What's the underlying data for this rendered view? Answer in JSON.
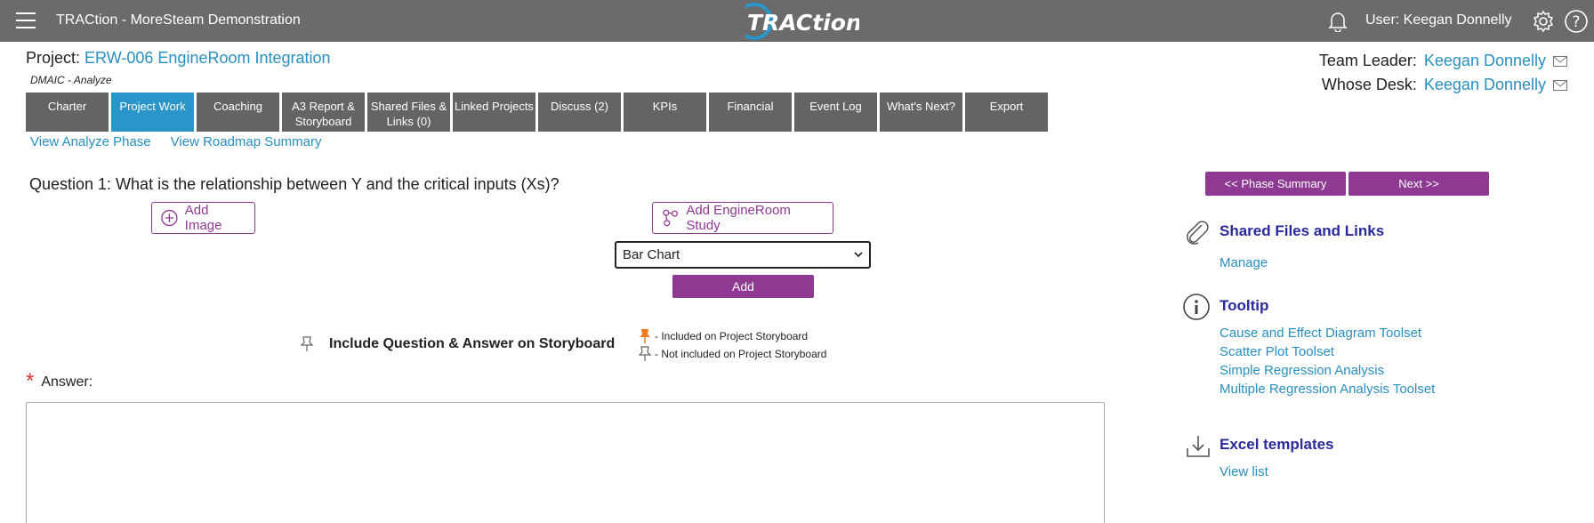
{
  "topbar": {
    "app_title": "TRACtion - MoreSteam Demonstration",
    "logo_text": "TRACtion",
    "user": "User: Keegan Donnelly"
  },
  "project": {
    "label": "Project:",
    "name": "ERW-006 EngineRoom Integration",
    "phase": "DMAIC - Analyze",
    "team_leader_label": "Team Leader:",
    "team_leader": "Keegan Donnelly",
    "whose_desk_label": "Whose Desk:",
    "whose_desk": "Keegan Donnelly"
  },
  "tabs": [
    {
      "label": "Charter",
      "active": false
    },
    {
      "label": "Project Work",
      "active": true
    },
    {
      "label": "Coaching",
      "active": false
    },
    {
      "label": "A3 Report & Storyboard",
      "active": false
    },
    {
      "label": "Shared Files & Links (0)",
      "active": false
    },
    {
      "label": "Linked Projects",
      "active": false
    },
    {
      "label": "Discuss (2)",
      "active": false
    },
    {
      "label": "KPIs",
      "active": false
    },
    {
      "label": "Financial",
      "active": false
    },
    {
      "label": "Event Log",
      "active": false
    },
    {
      "label": "What's Next?",
      "active": false
    },
    {
      "label": "Export",
      "active": false
    }
  ],
  "sublinks": {
    "analyze": "View Analyze Phase",
    "roadmap": "View Roadmap Summary"
  },
  "question": {
    "text": "Question 1: What is the relationship between Y and the critical inputs (Xs)?",
    "add_image": "Add Image",
    "add_engineroom": "Add EngineRoom Study",
    "chart_select": "Bar Chart",
    "add_button": "Add",
    "include_label": "Include Question & Answer on Storyboard",
    "legend_included": "- Included on Project Storyboard",
    "legend_not_included": "- Not included on Project Storyboard",
    "answer_label": "Answer:",
    "required_mark": "*"
  },
  "nav_buttons": {
    "phase_summary": "<< Phase Summary",
    "next": "Next >>"
  },
  "sidebar": {
    "shared_title": "Shared Files and Links",
    "shared_manage": "Manage",
    "tooltip_title": "Tooltip",
    "tooltip_links": [
      "Cause and Effect Diagram Toolset",
      "Scatter Plot Toolset",
      "Simple Regression Analysis",
      "Multiple Regression Analysis Toolset"
    ],
    "excel_title": "Excel templates",
    "excel_link": "View list"
  },
  "colors": {
    "topbar": "#6b6b6b",
    "accent_purple": "#8e3a93",
    "link_blue": "#2a8fc1",
    "active_tab": "#2a95c9",
    "tab_gray": "#646464",
    "heading_navy": "#2a2a9c"
  }
}
